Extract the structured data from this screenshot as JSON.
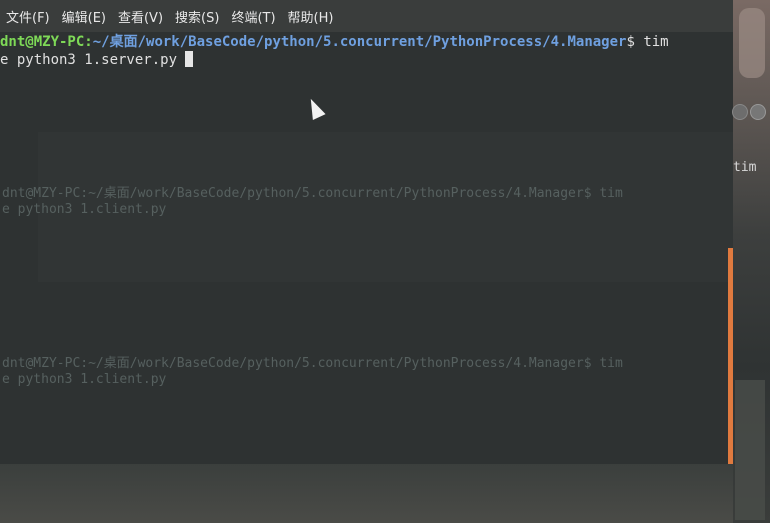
{
  "menu": {
    "items": [
      "文件(F)",
      "编辑(E)",
      "查看(V)",
      "搜索(S)",
      "终端(T)",
      "帮助(H)"
    ]
  },
  "terminal": {
    "prompt_user": "dnt@MZY-PC",
    "prompt_sep": ":",
    "prompt_path": "~/桌面/work/BaseCode/python/5.concurrent/PythonProcess/4.Manager",
    "prompt_symbol": "$ ",
    "command_part1": "tim",
    "command_part2": "e python3 1.server.py"
  },
  "ghost_terminal": {
    "line_a": "dnt@MZY-PC:~/桌面/work/BaseCode/python/5.concurrent/PythonProcess/4.Manager$ tim",
    "line_b": "e python3 1.client.py",
    "line_c": "dnt@MZY-PC:~/桌面/work/BaseCode/python/5.concurrent/PythonProcess/4.Manager$ tim",
    "line_d": "e python3 1.client.py",
    "right_tail": "tim"
  },
  "colors": {
    "user": "#7ed957",
    "path": "#6fa0e0",
    "scrollbar": "#e07a3f"
  }
}
